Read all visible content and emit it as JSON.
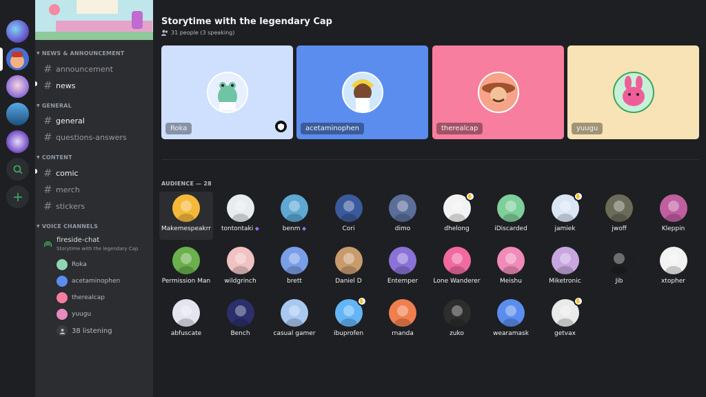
{
  "sidebar": {
    "categories": {
      "news": "NEWS & ANNOUNCEMENT",
      "general": "GENERAL",
      "content": "CONTENT",
      "voice": "VOICE CHANNELS"
    },
    "channels": {
      "announcement": "announcement",
      "news": "news",
      "general": "general",
      "qa": "questions-answers",
      "comic": "comic",
      "merch": "merch",
      "stickers": "stickers"
    },
    "voice": {
      "name": "fireside-chat",
      "topic": "Storytime with the legendary Cap",
      "members": [
        "Roka",
        "acetaminophen",
        "therealcap",
        "yuugu"
      ],
      "listening": "38 listening"
    }
  },
  "stage": {
    "title": "Storytime with the legendary Cap",
    "subtitle": "31 people (3 speaking)",
    "speakers": [
      "Roka",
      "acetaminophen",
      "therealcap",
      "yuugu"
    ]
  },
  "audience": {
    "label": "AUDIENCE — 28",
    "members": [
      "Makemespeakrr",
      "tontontaki",
      "benm",
      "Cori",
      "dimo",
      "dhelong",
      "iDiscarded",
      "jamiek",
      "jwoff",
      "Kleppin",
      "Permission Man",
      "wildgrinch",
      "brett",
      "Daniel D",
      "Entemper",
      "Lone Wanderer",
      "Meishu",
      "Miketronic",
      "Jib",
      "xtopher",
      "abfuscate",
      "Bench",
      "casual gamer",
      "ibuprofen",
      "rnanda",
      "zuko",
      "wearamask",
      "getvax"
    ]
  },
  "colors": {
    "tile_roka": "#cfe0ff",
    "tile_aceta": "#5b8def",
    "tile_cap": "#f77e9f",
    "tile_yuugu": "#f7e3b5",
    "stage_icon": "#3ba55c",
    "boost_gem": "#a16cf0"
  },
  "icons": [
    "search-icon",
    "plus-icon",
    "hash-icon",
    "stage-icon",
    "people-icon",
    "moderator-shield-icon",
    "raised-hand-icon",
    "headphones-icon"
  ]
}
